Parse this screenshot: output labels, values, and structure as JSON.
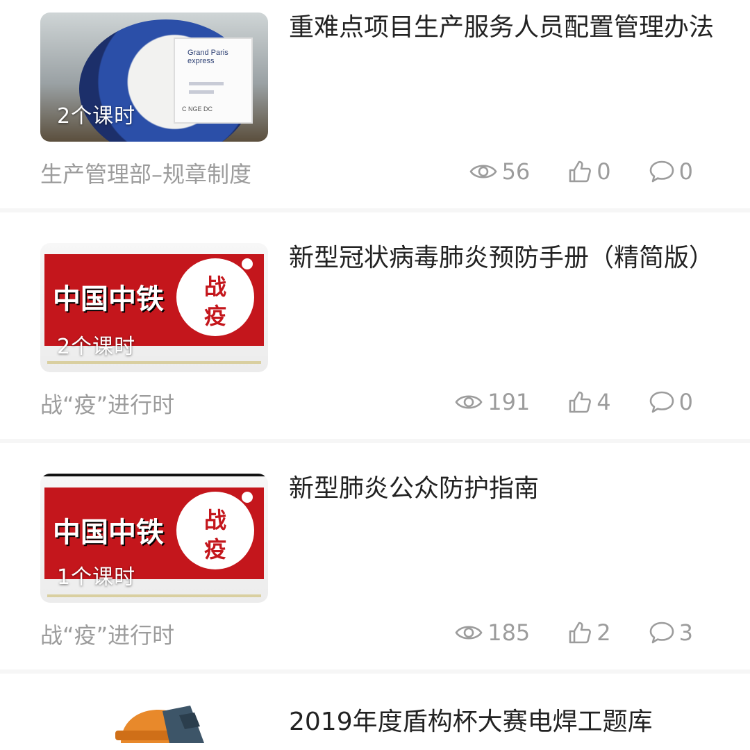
{
  "courses": [
    {
      "lessons": "2个课时",
      "title": "重难点项目生产服务人员配置管理办法",
      "category": "生产管理部–规章制度",
      "views": "56",
      "likes": "0",
      "comments": "0",
      "thumb_sign_text": "Grand Paris express",
      "thumb_caption": "C NGE DC"
    },
    {
      "lessons": "2个课时",
      "title": "新型冠状病毒肺炎预防手册（精简版）",
      "category": "战“疫”进行时",
      "views": "191",
      "likes": "4",
      "comments": "0",
      "thumb_brand": "中国中铁",
      "thumb_seal_top": "战",
      "thumb_seal_bottom": "疫"
    },
    {
      "lessons": "1个课时",
      "title": "新型肺炎公众防护指南",
      "category": "战“疫”进行时",
      "views": "185",
      "likes": "2",
      "comments": "3",
      "thumb_brand": "中国中铁",
      "thumb_seal_top": "战",
      "thumb_seal_bottom": "疫"
    },
    {
      "title": "2019年度盾构杯大赛电焊工题库"
    }
  ],
  "icons": {
    "views": "eye-icon",
    "likes": "thumbs-up-icon",
    "comments": "comment-bubble-icon"
  },
  "colors": {
    "meta_gray": "#9c9c9c",
    "title": "#222222",
    "divider": "#f6f6f6",
    "brand_red": "#c4161c"
  }
}
